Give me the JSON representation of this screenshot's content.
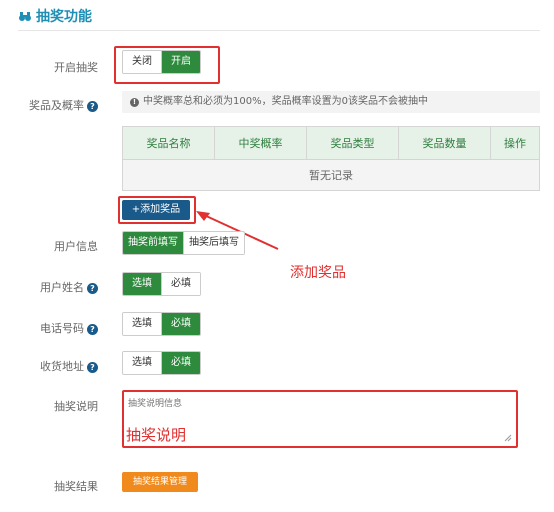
{
  "header": {
    "title": "抽奖功能"
  },
  "lottery": {
    "label": "开启抽奖",
    "off_label": "关闭",
    "on_label": "开启"
  },
  "prizes": {
    "label": "奖品及概率",
    "info": "中奖概率总和必须为100%，奖品概率设置为0该奖品不会被抽中",
    "columns": [
      "奖品名称",
      "中奖概率",
      "奖品类型",
      "奖品数量",
      "操作"
    ],
    "empty_text": "暂无记录",
    "add_button": "+添加奖品",
    "annotation": "添加奖品"
  },
  "user_info": {
    "label": "用户信息",
    "before_label": "抽奖前填写",
    "after_label": "抽奖后填写"
  },
  "name_field": {
    "label": "用户姓名",
    "optional": "选填",
    "required": "必填"
  },
  "phone_field": {
    "label": "电话号码",
    "optional": "选填",
    "required": "必填"
  },
  "address_field": {
    "label": "收货地址",
    "optional": "选填",
    "required": "必填"
  },
  "description": {
    "label": "抽奖说明",
    "placeholder": "抽奖说明信息",
    "annotation": "抽奖说明"
  },
  "result": {
    "label": "抽奖结果",
    "button": "抽奖结果管理"
  },
  "colors": {
    "accent": "#1f8fb5",
    "on_green": "#2e8b3e",
    "primary_blue": "#1a5a8a",
    "annotation_red": "#e03030",
    "orange": "#f08a1c"
  }
}
